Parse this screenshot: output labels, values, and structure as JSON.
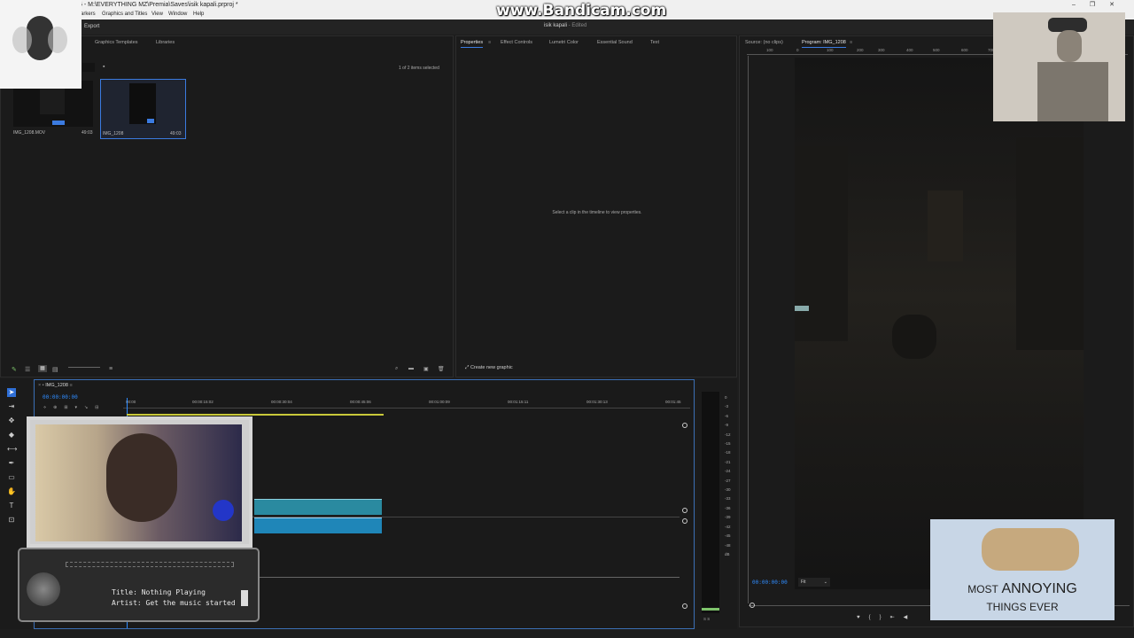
{
  "window": {
    "title": "Adobe Premiere Pro 2025 - M:\\EVERYTHING MZ\\Premia\\Saves\\isik kapali.prproj *",
    "controls": [
      "–",
      "❐",
      "✕"
    ]
  },
  "watermark": "www.Bandicam.com",
  "menu": [
    "arkers",
    "Graphics and Titles",
    "View",
    "Window",
    "Help"
  ],
  "header": {
    "export_label": "Export",
    "project_name": "isik kapali",
    "project_status": " - Edited"
  },
  "project_panel": {
    "tabs": [
      "Graphics Templates",
      "Libraries"
    ],
    "selection_info": "1 of 2 items selected",
    "items": [
      {
        "name": "IMG_1208.MOV",
        "duration": "49:03"
      },
      {
        "name": "IMG_1208",
        "duration": "49:03"
      }
    ]
  },
  "properties_panel": {
    "tabs": [
      "Properties",
      "Effect Controls",
      "Lumetri Color",
      "Essential Sound",
      "Text"
    ],
    "empty_message": "Select a clip in the timeline to view properties.",
    "create_graphic_label": "Create new graphic"
  },
  "program_monitor": {
    "source_tab": "Source: (no clips)",
    "program_tab": "Program: IMG_1208",
    "ruler_ticks": [
      "100",
      "0",
      "100",
      "200",
      "300",
      "400",
      "500",
      "600",
      "700"
    ],
    "timecode": "00:00:00:00",
    "fit_label": "Fit"
  },
  "timeline": {
    "sequence_tab": "IMG_1208",
    "timecode": "00:00:00:00",
    "ruler_labels": [
      "00:00",
      "00:00:15:02",
      "00:00:30:04",
      "00:00:45:06",
      "00:01:00:09",
      "00:01:15:11",
      "00:01:30:13",
      "00:01:45"
    ]
  },
  "audio_meter": {
    "scale": [
      "0",
      "-3",
      "-6",
      "-9",
      "-12",
      "-15",
      "-18",
      "-21",
      "-24",
      "-27",
      "-30",
      "-33",
      "-36",
      "-39",
      "-42",
      "-45",
      "-48",
      "dB"
    ],
    "footer": "S  S"
  },
  "music_player": {
    "title_line": "Title: Nothing Playing",
    "artist_line": "Artist: Get the music started"
  },
  "meme": {
    "line1_small": "MOST",
    "line1_big": "ANNOYING",
    "line2": "THINGS EVER"
  },
  "colors": {
    "accent": "#3b7be0",
    "clip_video": "#2a8aa0",
    "clip_audio": "#1f86b8",
    "timecode": "#2f8cff"
  }
}
